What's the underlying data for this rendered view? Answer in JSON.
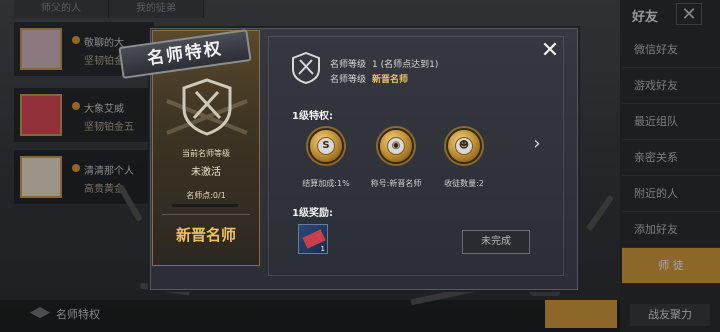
{
  "background": {
    "tabs": [
      "师父的人",
      "我的徒弟"
    ],
    "rows": [
      {
        "line1": "敬聊的大",
        "line2": "坚韧铂金"
      },
      {
        "line1": "大象艾威",
        "line2": "坚韧铂金五"
      },
      {
        "line1": "清清那个人",
        "line2": "高贵黄金"
      }
    ],
    "right_title": "好友",
    "close_glyph": "✕",
    "menu": [
      "微信好友",
      "游戏好友",
      "最近组队",
      "亲密关系",
      "附近的人",
      "添加好友",
      "师 徒"
    ],
    "bottom_left": "名师特权",
    "bottom_right": "战友聚力"
  },
  "modal": {
    "title": "名师特权",
    "close_glyph": "✕",
    "left_panel": {
      "current_level_label": "当前名师等级",
      "current_level_value": "未激活",
      "points_label": "名师点:0/1",
      "points_fraction": 0,
      "rank_title": "新晋名师"
    },
    "level_info": {
      "line1_label": "名师等级",
      "line1_value": "1 (名师点达到1)",
      "line2_label": "名师等级",
      "line2_value": "新晋名师"
    },
    "privileges": {
      "title": "1级特权:",
      "items": [
        {
          "icon": "settlement-bonus-medal-icon",
          "glyph": "S",
          "label": "结算加成:1%"
        },
        {
          "icon": "title-medal-icon",
          "glyph": "◉",
          "label": "称号:新晋名师"
        },
        {
          "icon": "disciple-count-medal-icon",
          "glyph": "☻",
          "label": "收徒数量:2"
        }
      ],
      "next_glyph": "›"
    },
    "rewards": {
      "title": "1级奖励:",
      "item_icon": "rename-card-reward-icon",
      "item_qty": "1",
      "status_button": "未完成"
    }
  },
  "colors": {
    "accent_gold": "#d9a040",
    "rank_text": "#f0c060"
  }
}
